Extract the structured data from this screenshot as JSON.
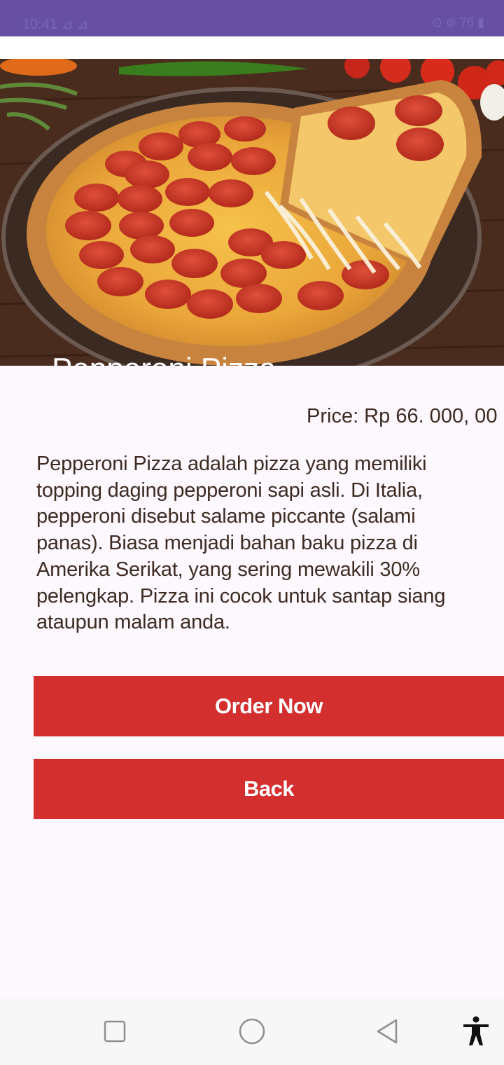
{
  "status_bar": {
    "time": "10:41 ⊿ ⊿",
    "icons": "⊙ ⊚ 76 ▮"
  },
  "item": {
    "name": "Pepperoni Pizza",
    "price": "Price: Rp 66. 000, 00",
    "description": "Pepperoni Pizza adalah pizza yang memiliki topping daging pepperoni sapi asli.  Di Italia, pepperoni disebut salame piccante (salami panas).  Biasa menjadi bahan baku pizza di Amerika Serikat,  yang sering mewakili 30% pelengkap.  Pizza ini cocok untuk santap siang ataupun malam anda."
  },
  "buttons": {
    "order": "Order Now",
    "back": "Back"
  },
  "nav": {
    "recents": "recents-icon",
    "home": "home-icon",
    "back": "back-icon",
    "accessibility": "accessibility-icon"
  },
  "colors": {
    "status_bar": "#6750a4",
    "button": "#d32f2f",
    "background": "#fdf8fd",
    "text": "#3d2b22"
  }
}
